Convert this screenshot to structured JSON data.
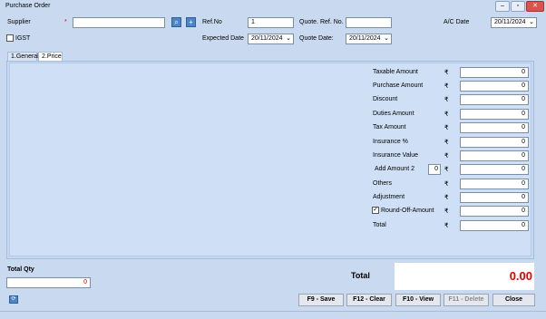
{
  "window": {
    "title": "Purchase Order"
  },
  "header": {
    "supplier_label": "Supplier",
    "required_star": "*",
    "supplier_value": "",
    "refno_label": "Ref.No",
    "refno_value": "1",
    "quote_ref_label": "Quote. Ref. No.",
    "quote_ref_value": "",
    "ac_date_label": "A/C Date",
    "ac_date_value": "20/11/2024",
    "igst_label": "IGST",
    "expected_date_label": "Expected Date",
    "expected_date_value": "20/11/2024",
    "quote_date_label": "Quote Date:",
    "quote_date_value": "20/11/2024"
  },
  "tabs": [
    {
      "label": "1.General"
    },
    {
      "label": "2.Price"
    }
  ],
  "price": {
    "currency": "₹",
    "rows": [
      {
        "label": "Taxable Amount",
        "value": "0"
      },
      {
        "label": "Purchase Amount",
        "value": "0"
      },
      {
        "label": "Discount",
        "value": "0"
      },
      {
        "label": "Duties Amount",
        "value": "0"
      },
      {
        "label": "Tax Amount",
        "value": "0"
      },
      {
        "label": "Insurance %",
        "value": "0"
      },
      {
        "label": "Insurance Value",
        "value": "0"
      },
      {
        "label": "Add Amount 2",
        "value": "0",
        "extra": "0"
      },
      {
        "label": "Others",
        "value": "0"
      },
      {
        "label": "Adjustment",
        "value": "0"
      },
      {
        "label": "Round-Off-Amount",
        "value": "0",
        "checked": true
      },
      {
        "label": "Total",
        "value": "0"
      }
    ]
  },
  "footer": {
    "total_qty_label": "Total Qty",
    "total_qty_value": "0",
    "total_label": "Total",
    "total_value": "0.00",
    "total_color": "#e00000",
    "buttons": {
      "save": "F9 - Save",
      "clear": "F12 - Clear",
      "view": "F10 - View",
      "delete": "F11 - Delete",
      "close": "Close"
    }
  }
}
